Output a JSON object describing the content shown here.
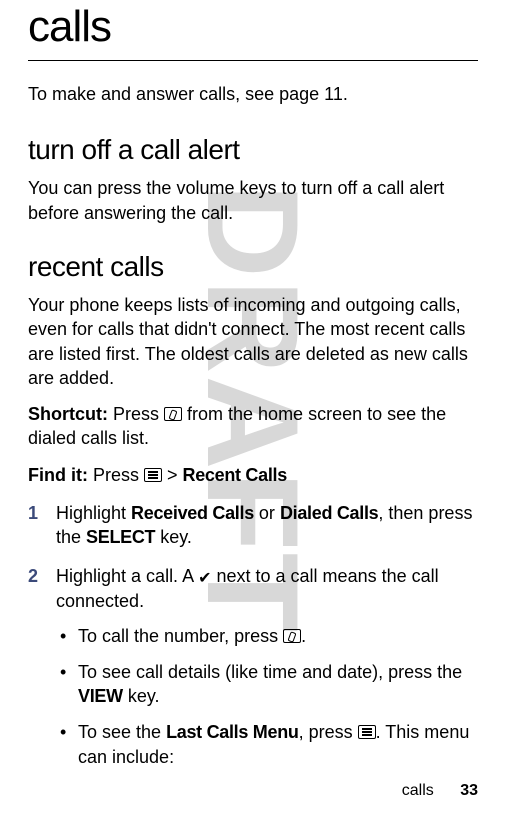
{
  "watermark": "DRAFT",
  "title": "calls",
  "intro": "To make and answer calls, see page 11.",
  "section1": {
    "heading": "turn off a call alert",
    "body": "You can press the volume keys to turn off a call alert before answering the call."
  },
  "section2": {
    "heading": "recent calls",
    "body": "Your phone keeps lists of incoming and outgoing calls, even for calls that didn't connect. The most recent calls are listed first. The oldest calls are deleted as new calls are added.",
    "shortcut_label": "Shortcut:",
    "shortcut_pre": " Press ",
    "shortcut_post": " from the home screen to see the dialed calls list.",
    "findit_label": "Find it:",
    "findit_pre": " Press ",
    "findit_sep": " > ",
    "findit_target": "Recent Calls",
    "steps": {
      "s1": {
        "num": "1",
        "pre": "Highlight ",
        "a": "Received Calls",
        "or": " or ",
        "b": "Dialed Calls",
        "mid": ", then press the ",
        "key": "SELECT",
        "post": " key."
      },
      "s2": {
        "num": "2",
        "pre": "Highlight a call. A ",
        "check": "✔",
        "post": " next to a call means the call connected.",
        "bullets": {
          "b1_pre": "To call the number, press ",
          "b1_post": ".",
          "b2_pre": "To see call details (like time and date), press the ",
          "b2_key": "VIEW",
          "b2_post": " key.",
          "b3_pre": "To see the ",
          "b3_menu": "Last Calls Menu",
          "b3_mid": ", press ",
          "b3_post": ". This menu can include:"
        }
      }
    }
  },
  "footer": {
    "label": "calls",
    "page": "33"
  }
}
